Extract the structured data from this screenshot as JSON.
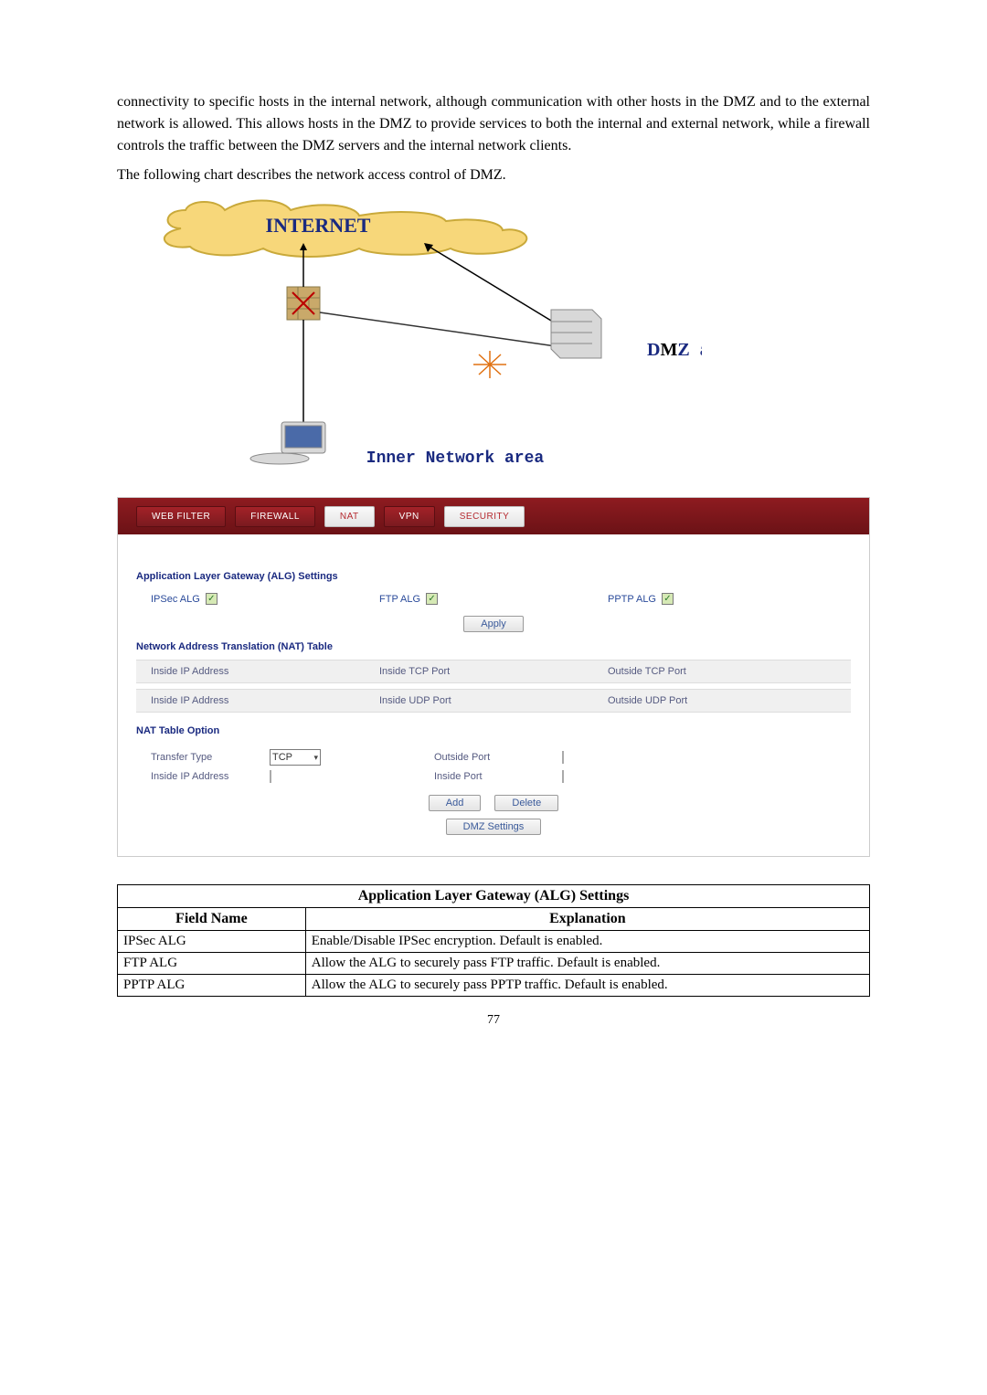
{
  "paragraphs": {
    "p1": "connectivity to specific hosts in the internal network, although communication with other hosts in the DMZ and to the external network is allowed. This allows hosts in the DMZ to provide services to both the internal and external network, while a firewall controls the traffic between the DMZ servers and the internal network clients.",
    "p2": "The following chart describes the network access control of DMZ."
  },
  "diagram": {
    "internet_label": "INTERNET",
    "dmz_label": "DMZ area",
    "inner_label": "Inner Network area"
  },
  "panel": {
    "tabs": {
      "web_filter": "WEB FILTER",
      "firewall": "FIREWALL",
      "nat": "NAT",
      "vpn": "VPN",
      "security": "SECURITY"
    },
    "alg": {
      "section_title": "Application Layer Gateway (ALG) Settings",
      "ipsec_label": "IPSec ALG",
      "ftp_label": "FTP ALG",
      "pptp_label": "PPTP ALG",
      "apply_btn": "Apply"
    },
    "nat_table": {
      "section_title": "Network Address Translation (NAT) Table",
      "col_inside_ip": "Inside IP Address",
      "col_inside_tcp": "Inside TCP Port",
      "col_outside_tcp": "Outside TCP Port",
      "col_inside_udp": "Inside UDP Port",
      "col_outside_udp": "Outside UDP Port"
    },
    "nat_option": {
      "section_title": "NAT Table Option",
      "transfer_type": "Transfer Type",
      "transfer_value": "TCP",
      "inside_ip": "Inside IP Address",
      "outside_port": "Outside Port",
      "inside_port": "Inside Port",
      "add_btn": "Add",
      "delete_btn": "Delete",
      "dmz_btn": "DMZ Settings"
    }
  },
  "definitions": {
    "title": "Application Layer Gateway (ALG) Settings",
    "hdr_field": "Field Name",
    "hdr_expl": "Explanation",
    "rows": [
      {
        "name": "IPSec ALG",
        "expl": "Enable/Disable IPSec encryption.   Default is enabled."
      },
      {
        "name": "FTP ALG",
        "expl": "Allow the ALG to securely pass FTP traffic. Default is enabled."
      },
      {
        "name": "PPTP ALG",
        "expl": "Allow the ALG to securely pass PPTP traffic. Default is enabled."
      }
    ]
  },
  "page_number": "77"
}
